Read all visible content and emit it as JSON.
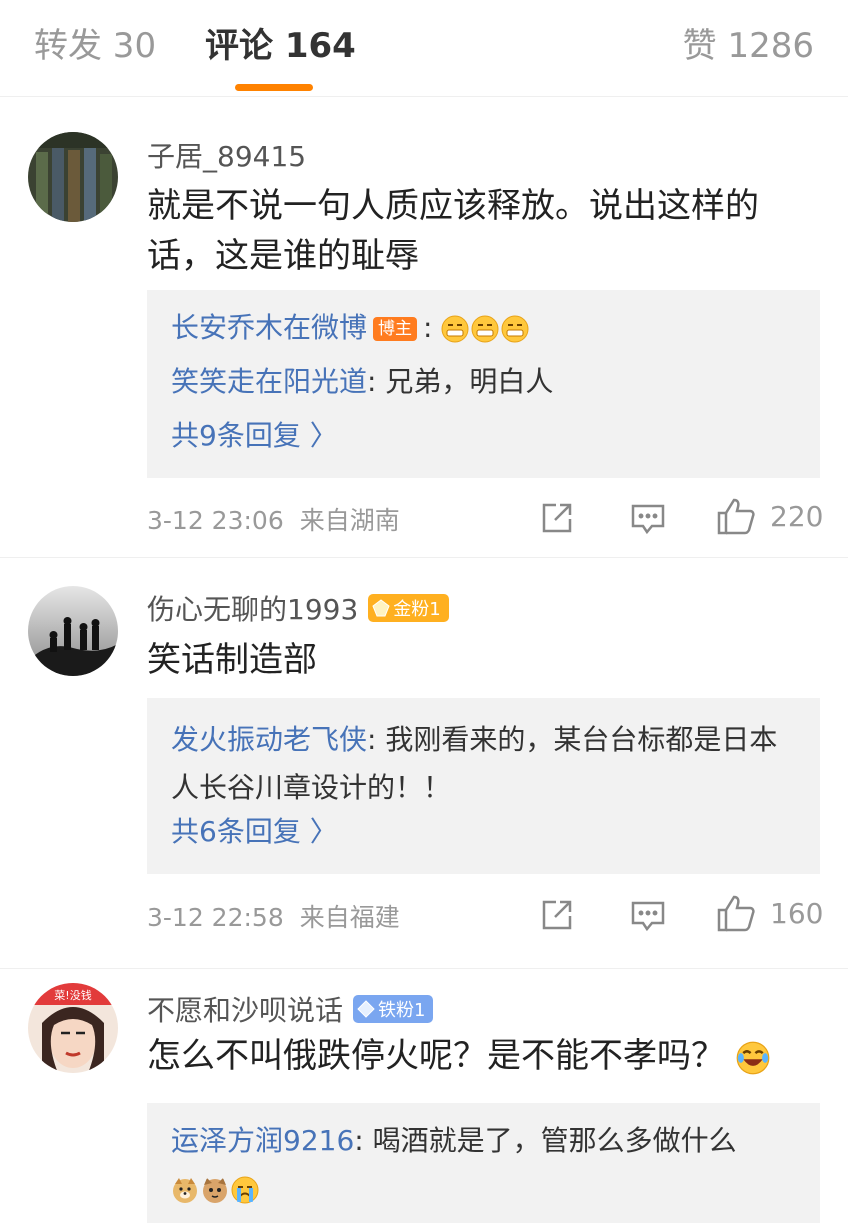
{
  "tabs": {
    "repost": "转发 30",
    "comments": "评论 164",
    "likes": "赞 1286",
    "accent": "#ff8200"
  },
  "comments": [
    {
      "username": "子居_89415",
      "text": "就是不说一句人质应该释放。说出这样的话，这是谁的耻辱",
      "replies": [
        {
          "name": "长安乔木在微博",
          "tag": "博主",
          "sep": ":",
          "emojis": [
            "grimace-emoji",
            "grimace-emoji",
            "grimace-emoji"
          ]
        },
        {
          "name": "笑笑走在阳光道",
          "sep": ":",
          "text": "兄弟，明白人"
        }
      ],
      "more_replies": "共9条回复 〉",
      "time": "3-12 23:06",
      "location": "来自湖南",
      "likes": "220"
    },
    {
      "username": "伤心无聊的1993",
      "badge": "金粉1",
      "text": "笑话制造部",
      "replies": [
        {
          "name": "发火振动老飞侠",
          "sep": ":",
          "text": "我刚看来的，某台台标都是日本人长谷川章设计的！！"
        }
      ],
      "more_replies": "共6条回复 〉",
      "time": "3-12 22:58",
      "location": "来自福建",
      "likes": "160"
    },
    {
      "username": "不愿和沙呗说话",
      "badge": "铁粉1",
      "text": "怎么不叫俄跌停火呢？是不能不孝吗？",
      "text_emoji": "laughing-tears-emoji",
      "replies": [
        {
          "name": "运泽方润9216",
          "sep": ":",
          "text": "喝酒就是了，管那么多做什么",
          "emojis": [
            "doge-emoji",
            "cat-emoji",
            "crying-emoji"
          ]
        }
      ]
    }
  ],
  "colors": {
    "link": "#4773b8",
    "meta": "#999999",
    "reply_bg": "#f2f2f2",
    "blogger_tag": "#ff7c1f",
    "gold_badge": "#ffb020",
    "iron_badge": "#7aa6f0"
  }
}
